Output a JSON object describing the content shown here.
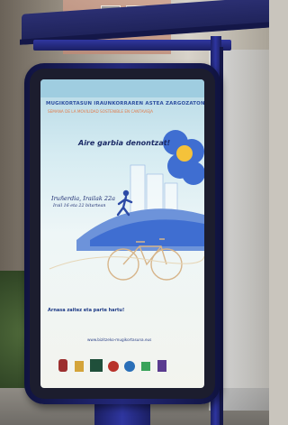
{
  "poster": {
    "title": "MUGIKORTASUN IRAUNKORRAREN ASTEA ZARGOZATON",
    "subtitle": "SEMANA DE LA MOVILIDAD SOSTENIBLE EN CANTAVIEJA",
    "slogan": "Aire garbia denontzat!",
    "handwriting_line1": "Iruñerdia, Irailak 22a",
    "handwriting_line2": "Irail 16 eta 22 bitartean",
    "note": "Arnasa zaitez eta parte hartu!",
    "website": "www.bizitzeko-mugikortasuna.eus",
    "colors": {
      "accent_blue": "#2d4fa0",
      "accent_orange": "#e27b4a",
      "flower_blue": "#3f6ed1"
    }
  }
}
